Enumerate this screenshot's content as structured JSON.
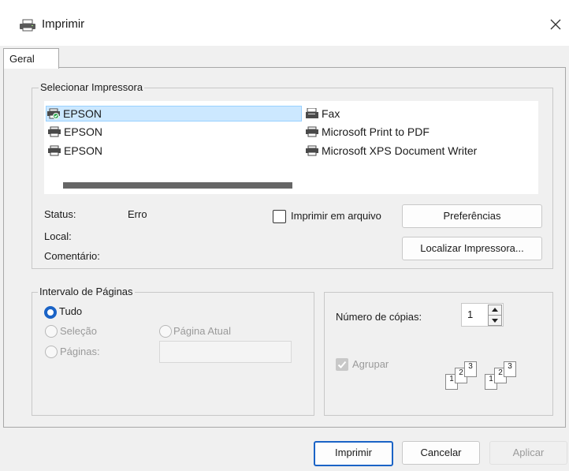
{
  "window": {
    "title": "Imprimir",
    "icon": "printer-icon",
    "close_icon": "close-icon"
  },
  "tabs": [
    {
      "label": "Geral",
      "selected": true
    }
  ],
  "printer_group": {
    "label": "Selecionar Impressora",
    "printers": [
      {
        "name": "EPSON",
        "selected": true,
        "default": true
      },
      {
        "name": "EPSON",
        "selected": false
      },
      {
        "name": "EPSON",
        "selected": false
      },
      {
        "name": "Fax",
        "selected": false
      },
      {
        "name": "Microsoft Print to PDF",
        "selected": false
      },
      {
        "name": "Microsoft XPS Document Writer",
        "selected": false
      }
    ],
    "status_label": "Status:",
    "status_value": "Erro",
    "location_label": "Local:",
    "comment_label": "Comentário:",
    "print_to_file_label": "Imprimir em arquivo",
    "print_to_file_checked": false,
    "preferences_button": "Preferências",
    "find_printer_button": "Localizar Impressora..."
  },
  "page_range": {
    "label": "Intervalo de Páginas",
    "options": {
      "all": "Tudo",
      "selection": "Seleção",
      "current_page": "Página Atual",
      "pages": "Páginas:"
    },
    "selected": "all",
    "pages_value": ""
  },
  "copies": {
    "label": "Número de cópias:",
    "value": "1",
    "collate_label": "Agrupar",
    "collate_checked": true,
    "collate_enabled": false,
    "collate_icons": [
      "1",
      "2",
      "3",
      "1",
      "2",
      "3"
    ]
  },
  "footer": {
    "print_button": "Imprimir",
    "cancel_button": "Cancelar",
    "apply_button": "Aplicar"
  },
  "colors": {
    "accent": "#1a63c6",
    "selection": "#cce8ff",
    "disabled": "#9a9a9a",
    "background": "#f0f0f0"
  }
}
